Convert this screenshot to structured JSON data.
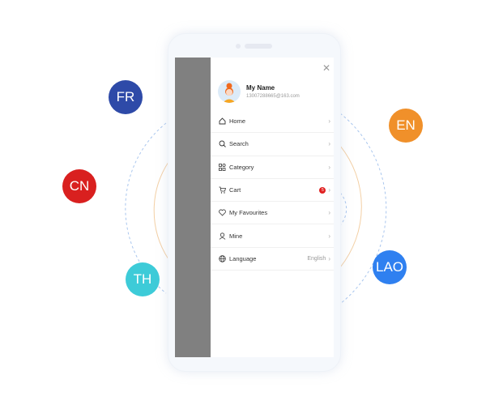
{
  "profile": {
    "name": "My Name",
    "email": "13007288665@163.com"
  },
  "menu": [
    {
      "icon": "home-icon",
      "label": "Home"
    },
    {
      "icon": "search-icon",
      "label": "Search"
    },
    {
      "icon": "category-icon",
      "label": "Category"
    },
    {
      "icon": "cart-icon",
      "label": "Cart",
      "badge": "5"
    },
    {
      "icon": "heart-icon",
      "label": "My Favourites"
    },
    {
      "icon": "user-icon",
      "label": "Mine"
    },
    {
      "icon": "globe-icon",
      "label": "Language",
      "value": "English"
    }
  ],
  "languages": [
    {
      "code": "FR",
      "color": "#2e4aa8"
    },
    {
      "code": "CN",
      "color": "#d9201f"
    },
    {
      "code": "TH",
      "color": "#3dcbd8"
    },
    {
      "code": "EN",
      "color": "#f0902a"
    },
    {
      "code": "LAO",
      "color": "#2f80f0"
    }
  ]
}
